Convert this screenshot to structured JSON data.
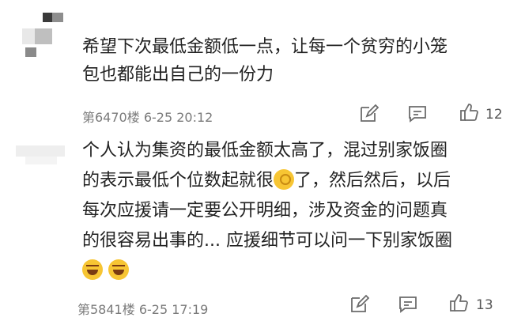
{
  "comments": [
    {
      "text_lines": [
        "希望下次最低金额低一点，让每一个贫穷的小笼",
        "包也都能出自己的一份力"
      ],
      "floor": "第6470楼",
      "time": "6-25 20:12",
      "likes": "12",
      "icons": [
        "edit-icon",
        "comment-icon",
        "thumbs-up-icon"
      ]
    },
    {
      "line1": "个人认为集资的最低金额太高了，混过别家饭圈",
      "line2_before": "的表示最低个位数起就很",
      "line2_after": "了，然后然后，以后",
      "line3": "每次应援请一定要公开明细，涉及资金的问题真",
      "line4": "的很容易出事的... 应援细节可以问一下别家饭圈",
      "emojis": [
        "ok-hand-emoji",
        "laughing-emoji",
        "laughing-emoji"
      ],
      "floor": "第5841楼",
      "time": "6-25 17:19",
      "likes": "13",
      "icons": [
        "edit-icon",
        "comment-icon",
        "thumbs-up-icon"
      ]
    }
  ],
  "colors": {
    "text": "#222222",
    "meta": "#7a7a7a",
    "icon": "#6b6b6b"
  }
}
